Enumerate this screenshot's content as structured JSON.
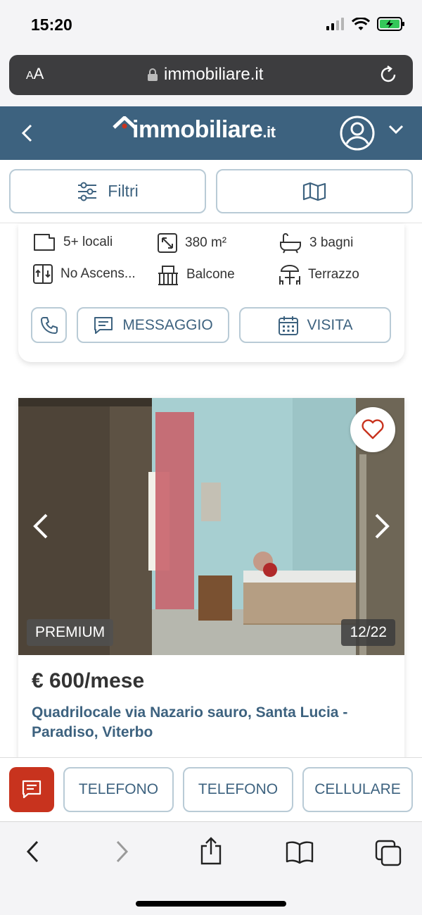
{
  "status_bar": {
    "time": "15:20",
    "battery_color": "#34c759"
  },
  "browser": {
    "text_size_label_small": "A",
    "text_size_label_large": "A",
    "url": "immobiliare.it"
  },
  "site_header": {
    "logo_main": "immobiliare",
    "logo_tld": ".it",
    "bg_color": "#3d627f"
  },
  "filters": {
    "filtri_label": "Filtri"
  },
  "card_top": {
    "features": [
      {
        "icon": "rooms-icon",
        "label": "5+ locali"
      },
      {
        "icon": "area-icon",
        "label": "380 m²"
      },
      {
        "icon": "bathtub-icon",
        "label": "3 bagni"
      },
      {
        "icon": "elevator-icon",
        "label": "No Ascens..."
      },
      {
        "icon": "balcony-icon",
        "label": "Balcone"
      },
      {
        "icon": "terrace-icon",
        "label": "Terrazzo"
      }
    ],
    "actions": {
      "message_label": "MESSAGGIO",
      "visit_label": "VISITA"
    }
  },
  "listing": {
    "badge": "PREMIUM",
    "photo_counter": "12/22",
    "price": "€ 600/mese",
    "title": "Quadrilocale via Nazario sauro, Santa Lucia - Paradiso, Viterbo"
  },
  "contact_bar": {
    "accent_color": "#c8331e",
    "buttons": [
      "TELEFONO",
      "TELEFONO",
      "CELLULARE"
    ]
  }
}
